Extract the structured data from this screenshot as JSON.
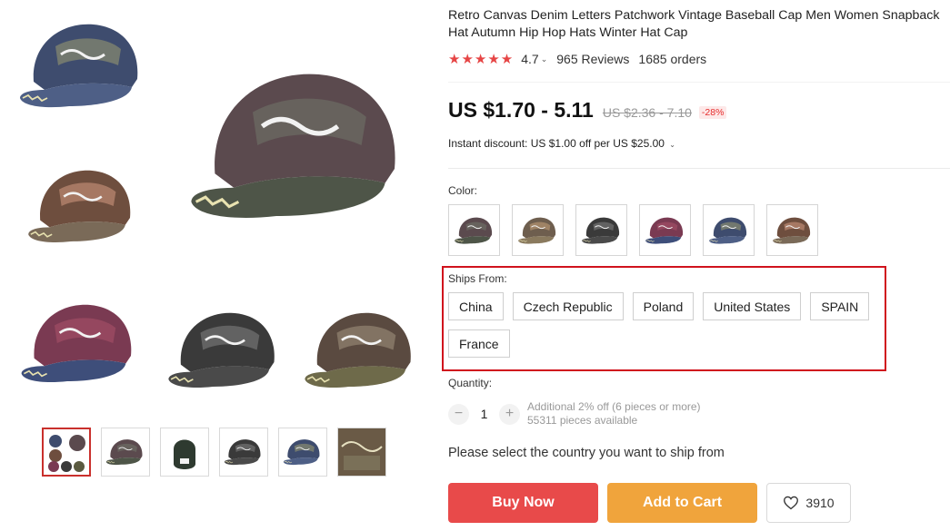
{
  "product": {
    "title": "Retro Canvas Denim Letters Patchwork Vintage Baseball Cap Men Women Snapback Hat Autumn Hip Hop Hats Winter Hat Cap"
  },
  "rating": {
    "stars": "★★★★★",
    "score": "4.7",
    "chevron": "⌄",
    "reviews": "965 Reviews",
    "orders": "1685 orders"
  },
  "price": {
    "current": "US $1.70 - 5.11",
    "original": "US $2.36 - 7.10",
    "discount": "-28%"
  },
  "instant_discount": {
    "text": "Instant discount: US $1.00 off per US $25.00",
    "chevron": "⌄"
  },
  "color": {
    "label": "Color:",
    "swatches": [
      "olive-green-cap",
      "khaki-cap",
      "black-cap",
      "wine-red-cap",
      "navy-blue-cap",
      "coffee-cap"
    ]
  },
  "ships_from": {
    "label": "Ships From:",
    "options": [
      "China",
      "Czech Republic",
      "Poland",
      "United States",
      "SPAIN",
      "France"
    ]
  },
  "quantity": {
    "label": "Quantity:",
    "minus": "−",
    "value": "1",
    "plus": "+",
    "offer": "Additional 2% off (6 pieces or more)",
    "available": "55311 pieces available"
  },
  "notice": "Please select the country you want to ship from",
  "actions": {
    "buy_now": "Buy Now",
    "add_to_cart": "Add to Cart",
    "wishlist_count": "3910"
  },
  "colors": {
    "accent_red": "#e84a4a",
    "cart_orange": "#f0a43c",
    "highlight_border": "#d0121d",
    "star_red": "#e64545"
  }
}
